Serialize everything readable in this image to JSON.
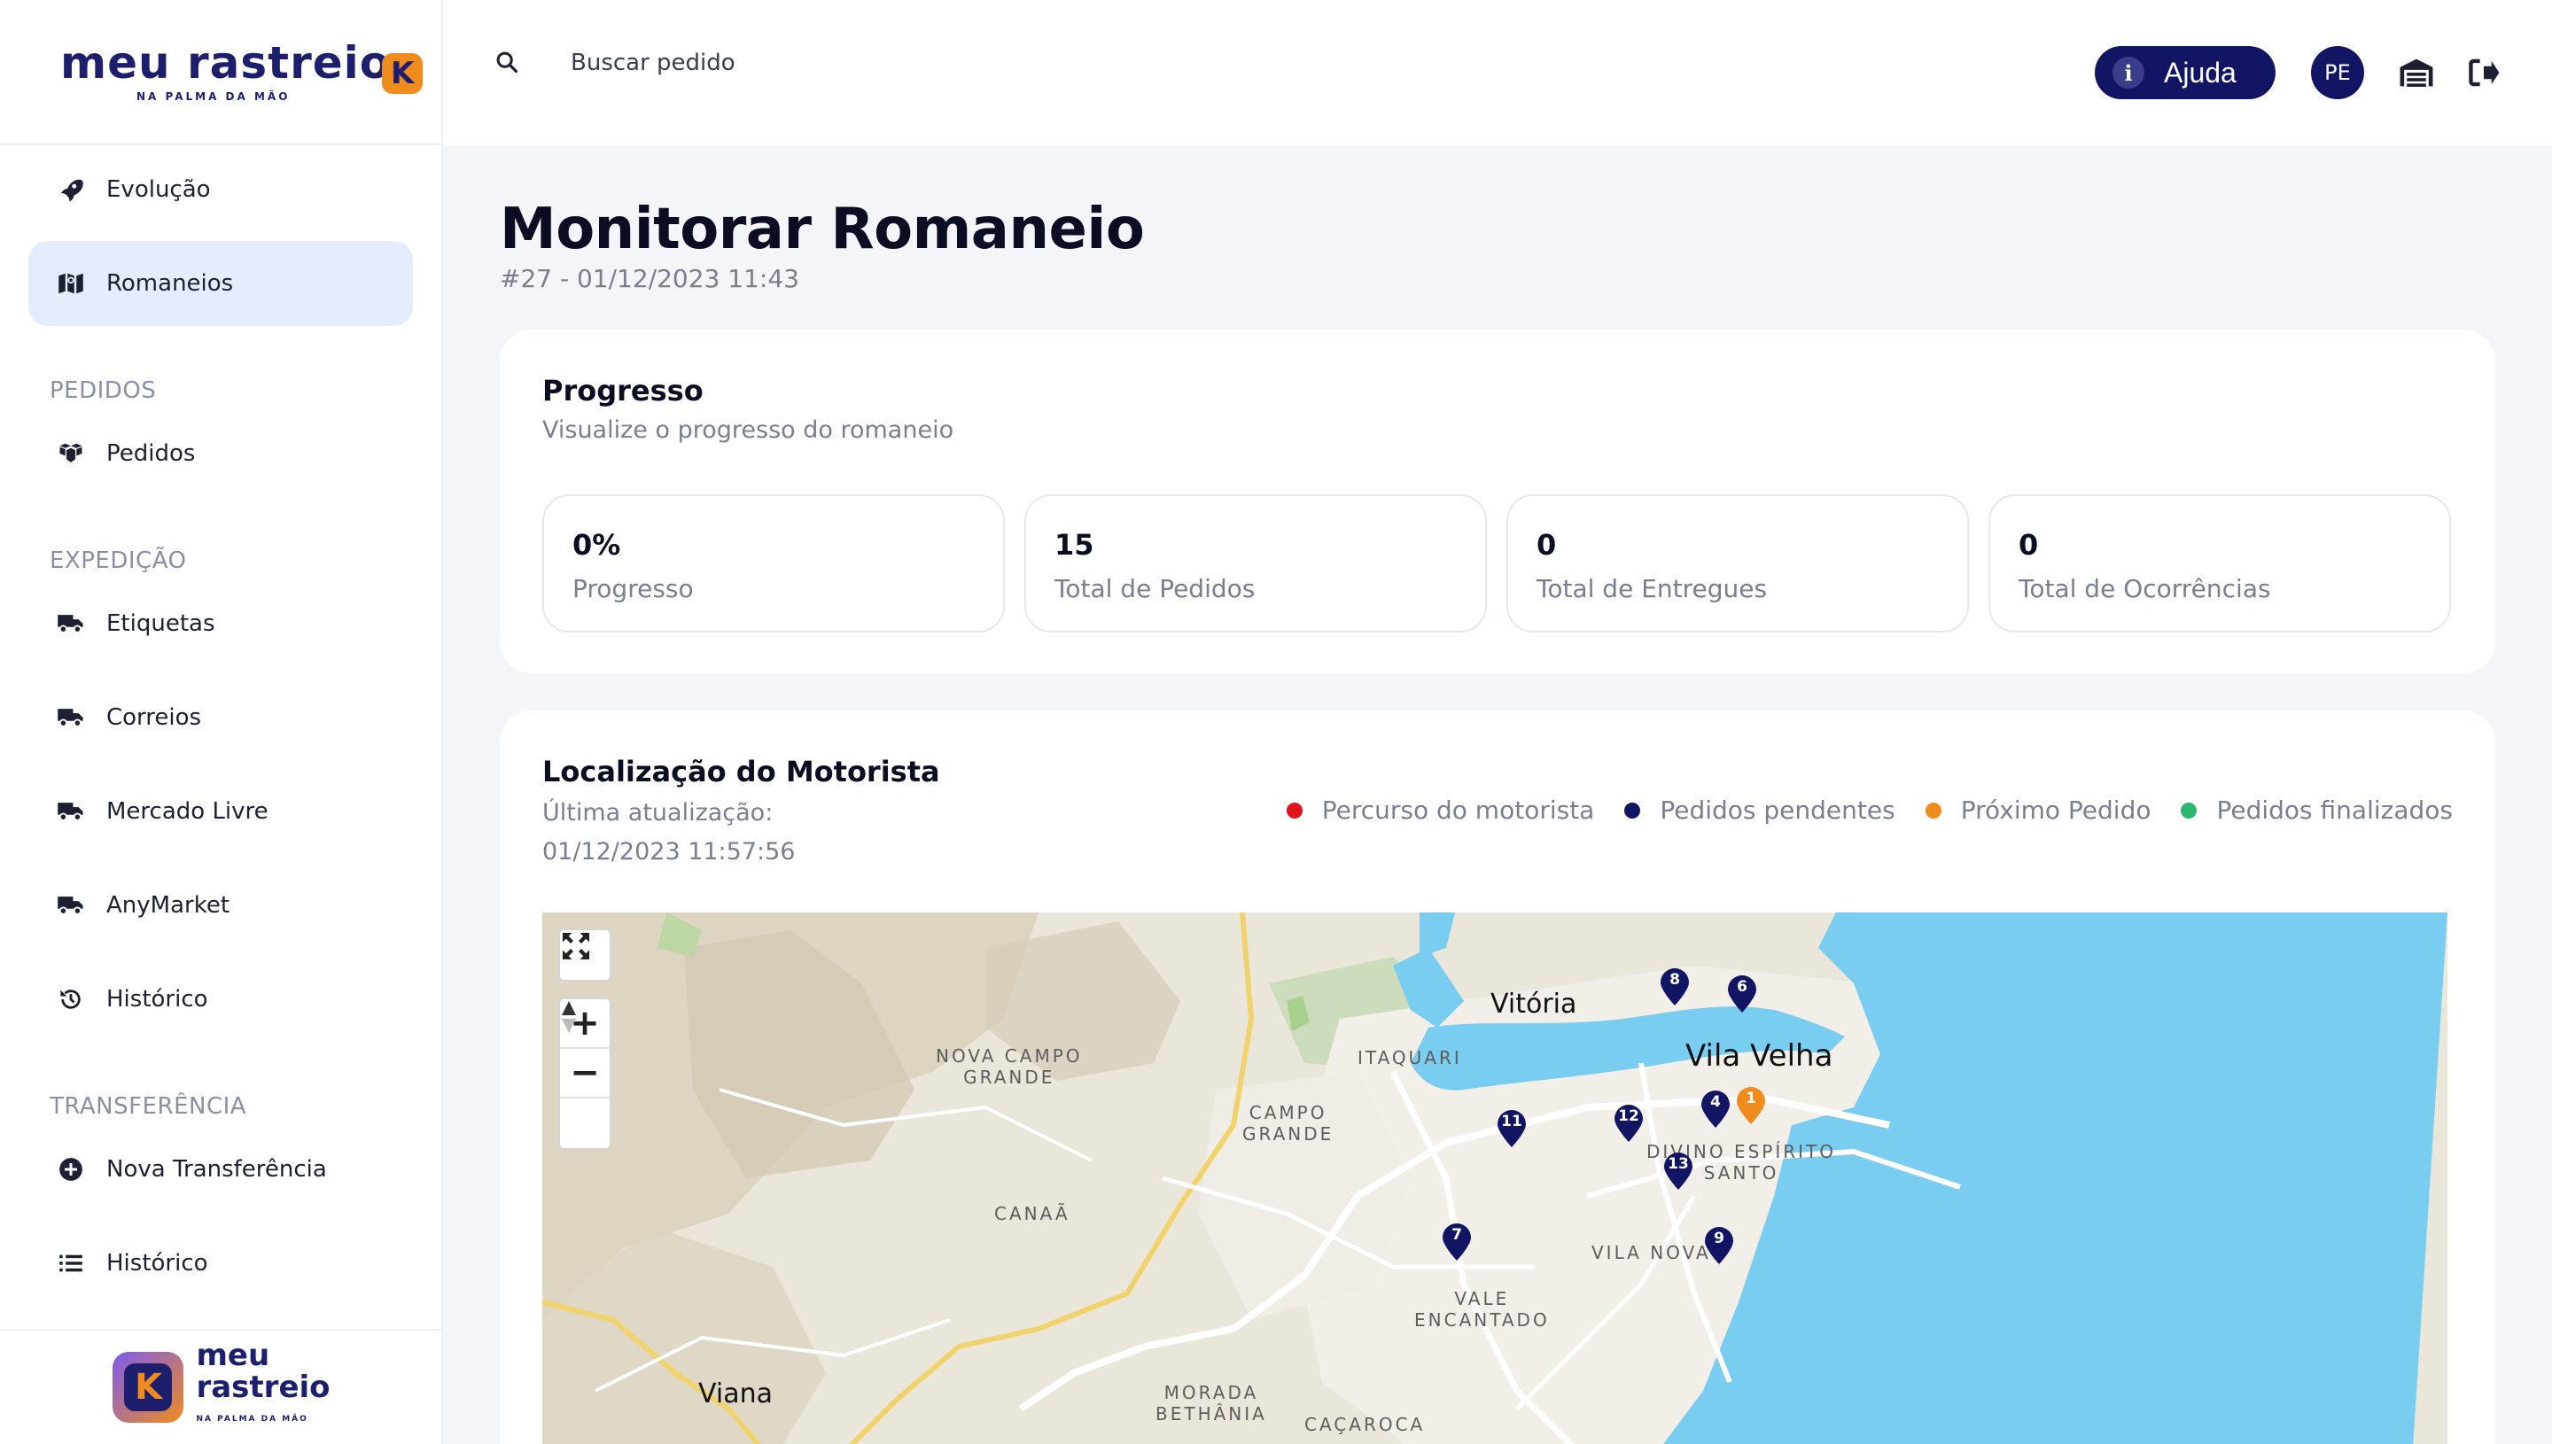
{
  "brand": {
    "logo_word": "meu rastreio",
    "logo_tagline": "NA PALMA DA MÃO",
    "bottom_word_1": "meu",
    "bottom_word_2": "rastreio",
    "bottom_tagline": "NA PALMA DA MÃO",
    "accent": "#f08b1d",
    "primary": "#121464"
  },
  "sidebar": {
    "top_items": [
      {
        "label": "Evolução",
        "icon": "rocket-icon"
      },
      {
        "label": "Romaneios",
        "icon": "map-icon",
        "active": true
      }
    ],
    "sections": [
      {
        "title": "PEDIDOS",
        "items": [
          {
            "label": "Pedidos",
            "icon": "boxes-icon"
          }
        ]
      },
      {
        "title": "EXPEDIÇÃO",
        "items": [
          {
            "label": "Etiquetas",
            "icon": "truck-icon"
          },
          {
            "label": "Correios",
            "icon": "truck-icon"
          },
          {
            "label": "Mercado Livre",
            "icon": "truck-icon"
          },
          {
            "label": "AnyMarket",
            "icon": "truck-icon"
          },
          {
            "label": "Histórico",
            "icon": "history-icon"
          }
        ]
      },
      {
        "title": "TRANSFERÊNCIA",
        "items": [
          {
            "label": "Nova Transferência",
            "icon": "plus-circle-icon"
          },
          {
            "label": "Histórico",
            "icon": "list-icon"
          }
        ]
      }
    ]
  },
  "header": {
    "search_placeholder": "Buscar pedido",
    "help_label": "Ajuda",
    "help_icon_letter": "i",
    "avatar_initials": "PE"
  },
  "page": {
    "title": "Monitorar Romaneio",
    "subtitle": "#27 - 01/12/2023 11:43"
  },
  "progress": {
    "title": "Progresso",
    "description": "Visualize o progresso do romaneio",
    "stats": [
      {
        "value": "0%",
        "label": "Progresso"
      },
      {
        "value": "15",
        "label": "Total de Pedidos"
      },
      {
        "value": "0",
        "label": "Total de Entregues"
      },
      {
        "value": "0",
        "label": "Total de Ocorrências"
      }
    ]
  },
  "driver_location": {
    "title": "Localização do Motorista",
    "last_update_label": "Última atualização:",
    "last_update_value": "01/12/2023 11:57:56",
    "legend": [
      {
        "label": "Percurso do motorista",
        "color": "#e0141e"
      },
      {
        "label": "Pedidos pendentes",
        "color": "#121464"
      },
      {
        "label": "Próximo Pedido",
        "color": "#f08b1d"
      },
      {
        "label": "Pedidos finalizados",
        "color": "#2bb673"
      }
    ],
    "map": {
      "controls": {
        "fullscreen_icon": "expand-icon",
        "zoom_in": "+",
        "zoom_out": "−",
        "compass_icon": "compass-icon"
      },
      "places": [
        {
          "name": "Vitória",
          "size": "mid"
        },
        {
          "name": "Vila Velha",
          "size": "big"
        },
        {
          "name": "NOVA CAMPO\nGRANDE",
          "size": "small"
        },
        {
          "name": "ITAQUARI",
          "size": "small"
        },
        {
          "name": "CAMPO\nGRANDE",
          "size": "small"
        },
        {
          "name": "CANAÃ",
          "size": "small"
        },
        {
          "name": "DIVINO ESPÍRITO\nSANTO",
          "size": "small"
        },
        {
          "name": "VILA NOVA",
          "size": "small"
        },
        {
          "name": "VALE\nENCANTADO",
          "size": "small"
        },
        {
          "name": "Viana",
          "size": "mid"
        },
        {
          "name": "MORADA\nBETHÂNIA",
          "size": "small"
        },
        {
          "name": "CAÇAROCA",
          "size": "small"
        }
      ],
      "pins": [
        {
          "number": "8",
          "status": "pending"
        },
        {
          "number": "6",
          "status": "pending"
        },
        {
          "number": "4",
          "status": "pending"
        },
        {
          "number": "1",
          "status": "next"
        },
        {
          "number": "12",
          "status": "pending"
        },
        {
          "number": "11",
          "status": "pending"
        },
        {
          "number": "13",
          "status": "pending"
        },
        {
          "number": "7",
          "status": "pending"
        },
        {
          "number": "9",
          "status": "pending"
        }
      ]
    }
  }
}
